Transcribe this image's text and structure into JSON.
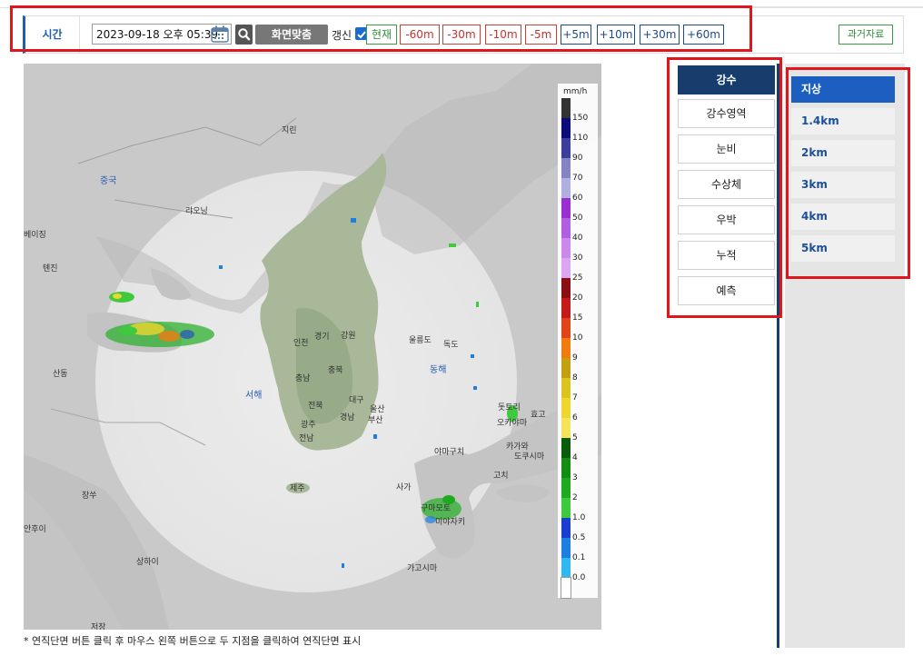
{
  "time_bar": {
    "label": "시간",
    "datetime_value": "2023-09-18 오후 05:39",
    "fit_label": "화면맞춤",
    "refresh_label": "갱신",
    "refresh_checked": true,
    "steps": [
      "현재",
      "-60m",
      "-30m",
      "-10m",
      "-5m",
      "+5m",
      "+10m",
      "+30m",
      "+60m"
    ],
    "past_label": "과거자료"
  },
  "map": {
    "legend": {
      "unit": "mm/h",
      "values": [
        "150",
        "110",
        "90",
        "70",
        "60",
        "50",
        "40",
        "30",
        "25",
        "20",
        "15",
        "10",
        "9",
        "8",
        "7",
        "6",
        "5",
        "4",
        "3",
        "2",
        "1.0",
        "0.5",
        "0.1",
        "0.0"
      ],
      "colors": [
        "#333333",
        "#0b0b7a",
        "#3d3d9c",
        "#8484c4",
        "#b0b0e0",
        "#9a2fd1",
        "#b25ee0",
        "#cc88ec",
        "#dba5f2",
        "#8a0f14",
        "#c41a1a",
        "#e14418",
        "#f07c10",
        "#c2a010",
        "#dcc420",
        "#eed62e",
        "#f5e35a",
        "#0a5c0a",
        "#138c13",
        "#1ea91e",
        "#3ec93e",
        "#1a3fd0",
        "#1e7fe0",
        "#32b8f0",
        "#ffffff"
      ]
    },
    "places": {
      "jilin": "지린",
      "china": "중국",
      "liaoning": "랴오닝",
      "tianjin": "톈진",
      "beijing_partial": "베이징",
      "shandong": "산동",
      "yellow_sea": "서해",
      "jiangsu": "장쑤",
      "shanghai": "상하이",
      "zhejiang": "저장",
      "anhui_partial": "안후이",
      "incheon": "인천",
      "gyeonggi": "경기",
      "gangwon": "강원",
      "chungnam": "충남",
      "chungbuk": "충북",
      "jeonbuk": "전북",
      "daegu": "대구",
      "ulsan": "울산",
      "gwangju": "광주",
      "gyeongnam": "경남",
      "busan": "부산",
      "jeonnam": "전남",
      "jeju": "제주",
      "ulleungdo": "울릉도",
      "dokdo": "독도",
      "east_sea": "동해",
      "tottori": "돗토리",
      "okayama": "오카야마",
      "hyogo": "효고",
      "yamaguchi": "야마구치",
      "kagawa": "카가와",
      "tokushima": "도쿠시마",
      "kochi": "고치",
      "saga": "사가",
      "kumamoto": "구마모토",
      "miyazaki": "미야자키",
      "kagoshima": "가고시마"
    }
  },
  "note": "* 연직단면 버튼 클릭 후 마우스 왼쪽 버튼으로 두 지점을 클릭하여 연직단면 표시",
  "type_panel": {
    "active_index": 0,
    "items": [
      "강수",
      "강수영역",
      "눈비",
      "수상체",
      "우박",
      "누적",
      "예측"
    ]
  },
  "altitude_panel": {
    "active_index": 0,
    "items": [
      "지상",
      "1.4km",
      "2km",
      "3km",
      "4km",
      "5km"
    ]
  },
  "colors": {
    "accent_blue": "#1c5fb0",
    "now_green": "#2f8c3a",
    "minus_red": "#c9302c",
    "plus_navy": "#1e4b82",
    "type_active": "#163d6b",
    "alt_active": "#1c5fc1",
    "highlight_red": "#e0161d"
  }
}
